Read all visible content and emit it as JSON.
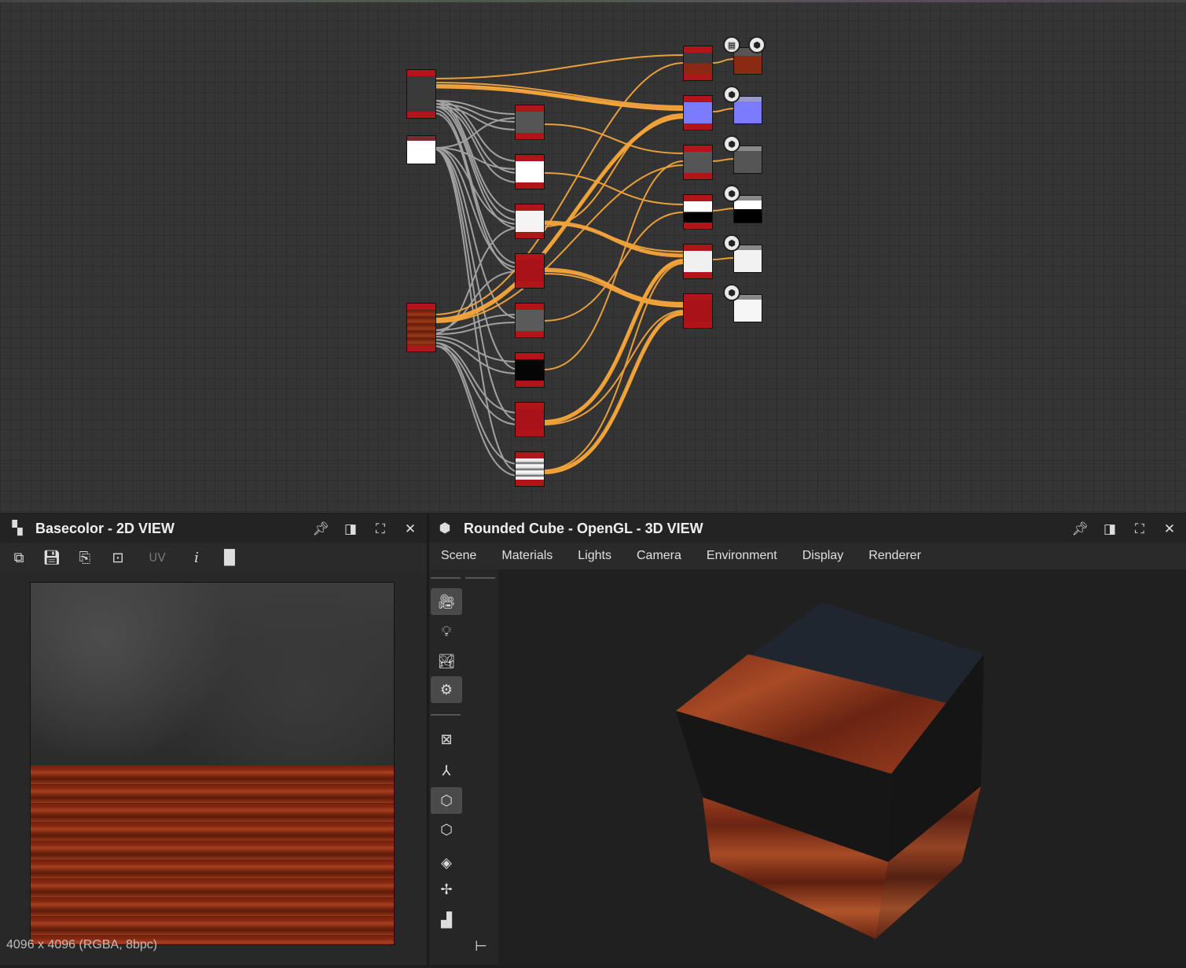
{
  "left_panel": {
    "title": "Basecolor - 2D VIEW",
    "toolbar": {
      "uv_label": "UV"
    },
    "status_text": "4096 x 4096 (RGBA, 8bpc)"
  },
  "right_panel": {
    "title": "Rounded Cube - OpenGL - 3D VIEW",
    "menu": [
      "Scene",
      "Materials",
      "Lights",
      "Camera",
      "Environment",
      "Display",
      "Renderer"
    ]
  },
  "icons": {
    "left_header": "checker-icon",
    "right_header": "cube-icon",
    "pin": "pin-icon",
    "restore": "restore-icon",
    "maximize": "maximize-icon",
    "close": "close-icon"
  },
  "colors": {
    "node_bar": "#b0151a",
    "link_color": "#f5a53a",
    "link_gray": "#b4b4b4",
    "normal_blue": "#7b7bff",
    "wood": "#8a2a12"
  }
}
